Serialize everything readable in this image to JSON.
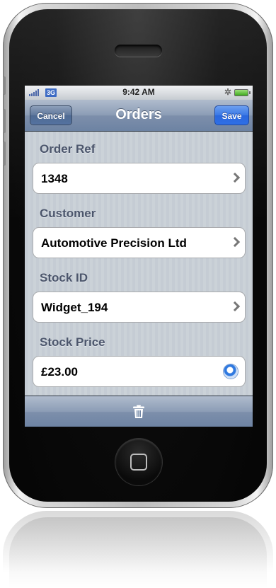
{
  "status_bar": {
    "network": "3G",
    "time": "9:42 AM",
    "icons": [
      "signal-icon",
      "bluetooth-icon",
      "battery-icon"
    ]
  },
  "nav": {
    "title": "Orders",
    "cancel_label": "Cancel",
    "save_label": "Save"
  },
  "fields": [
    {
      "label": "Order Ref",
      "value": "1348",
      "accessory": "chevron"
    },
    {
      "label": "Customer",
      "value": "Automotive Precision Ltd",
      "accessory": "chevron"
    },
    {
      "label": "Stock ID",
      "value": "Widget_194",
      "accessory": "chevron"
    },
    {
      "label": "Stock Price",
      "value": "£23.00",
      "accessory": "detail-disclosure"
    }
  ],
  "toolbar": {
    "icons": [
      "trash-icon"
    ]
  },
  "colors": {
    "nav_bar": "#8b9cb5",
    "save_button": "#3977e5",
    "section_label": "#4c566c",
    "background": "#c5ccd4"
  }
}
